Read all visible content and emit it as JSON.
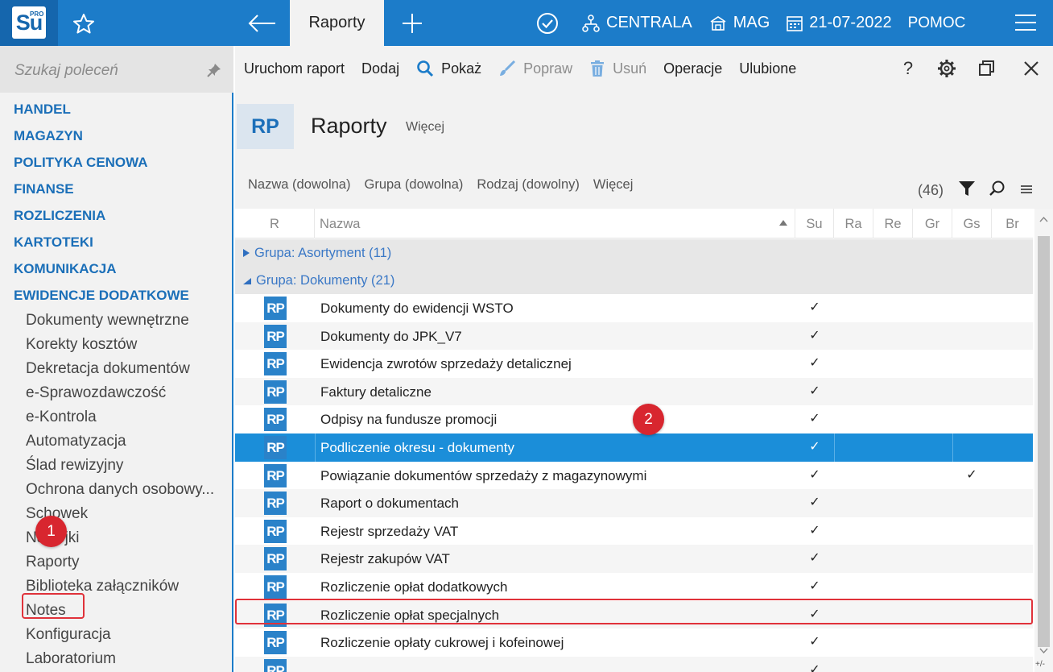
{
  "topbar": {
    "logo_text": "Su",
    "logo_sup": "PRO",
    "active_tab": "Raporty",
    "centrala": "CENTRALA",
    "mag": "MAG",
    "date": "21-07-2022",
    "pomoc": "POMOC"
  },
  "sidebar": {
    "search_placeholder": "Szukaj poleceń",
    "categories": [
      "HANDEL",
      "MAGAZYN",
      "POLITYKA CENOWA",
      "FINANSE",
      "ROZLICZENIA",
      "KARTOTEKI",
      "KOMUNIKACJA",
      "EWIDENCJE DODATKOWE"
    ],
    "sub_items": [
      "Dokumenty wewnętrzne",
      "Korekty kosztów",
      "Dekretacja dokumentów",
      "e-Sprawozdawczość",
      "e-Kontrola",
      "Automatyzacja",
      "Ślad rewizyjny",
      "Ochrona danych osobowy...",
      "Schowek",
      "Naklejki",
      "Raporty",
      "Biblioteka załączników",
      "Notes",
      "Konfiguracja",
      "Laboratorium"
    ]
  },
  "toolbar": {
    "run": "Uruchom raport",
    "add": "Dodaj",
    "show": "Pokaż",
    "edit": "Popraw",
    "delete": "Usuń",
    "operations": "Operacje",
    "favorites": "Ulubione",
    "help": "?"
  },
  "header": {
    "badge": "RP",
    "title": "Raporty",
    "more": "Więcej"
  },
  "filters": {
    "name": "Nazwa (dowolna)",
    "group": "Grupa (dowolna)",
    "kind": "Rodzaj (dowolny)",
    "more": "Więcej",
    "count": "(46)"
  },
  "grid": {
    "columns": [
      "R",
      "Nazwa",
      "Su",
      "Ra",
      "Re",
      "Gr",
      "Gs",
      "Br"
    ],
    "groups": [
      {
        "label": "Grupa: Asortyment (11)",
        "collapsed": true
      },
      {
        "label": "Grupa: Dokumenty (21)",
        "collapsed": false
      }
    ],
    "row_icon": "RP",
    "check": "✓",
    "rows": [
      {
        "name": "Dokumenty do ewidencji WSTO",
        "su": true,
        "gs": false
      },
      {
        "name": "Dokumenty do JPK_V7",
        "su": true,
        "gs": false
      },
      {
        "name": "Ewidencja zwrotów sprzedaży detalicznej",
        "su": true,
        "gs": false
      },
      {
        "name": "Faktury detaliczne",
        "su": true,
        "gs": false
      },
      {
        "name": "Odpisy na fundusze promocji",
        "su": true,
        "gs": false
      },
      {
        "name": "Podliczenie okresu - dokumenty",
        "su": true,
        "gs": false,
        "selected": true
      },
      {
        "name": "Powiązanie dokumentów sprzedaży z magazynowymi",
        "su": true,
        "gs": true
      },
      {
        "name": "Raport o dokumentach",
        "su": true,
        "gs": false
      },
      {
        "name": "Rejestr sprzedaży VAT",
        "su": true,
        "gs": false
      },
      {
        "name": "Rejestr zakupów VAT",
        "su": true,
        "gs": false
      },
      {
        "name": "Rozliczenie opłat dodatkowych",
        "su": true,
        "gs": false
      },
      {
        "name": "Rozliczenie opłat specjalnych",
        "su": true,
        "gs": false
      },
      {
        "name": "Rozliczenie opłaty cukrowej i kofeinowej",
        "su": true,
        "gs": false
      },
      {
        "name": "",
        "su": true,
        "gs": false
      }
    ],
    "corner": "+/-"
  },
  "annotations": {
    "step1": "1",
    "step2": "2"
  },
  "colors": {
    "accent": "#1c7cc9",
    "selected_row": "#1b8ed9",
    "highlight": "#e0323a"
  }
}
